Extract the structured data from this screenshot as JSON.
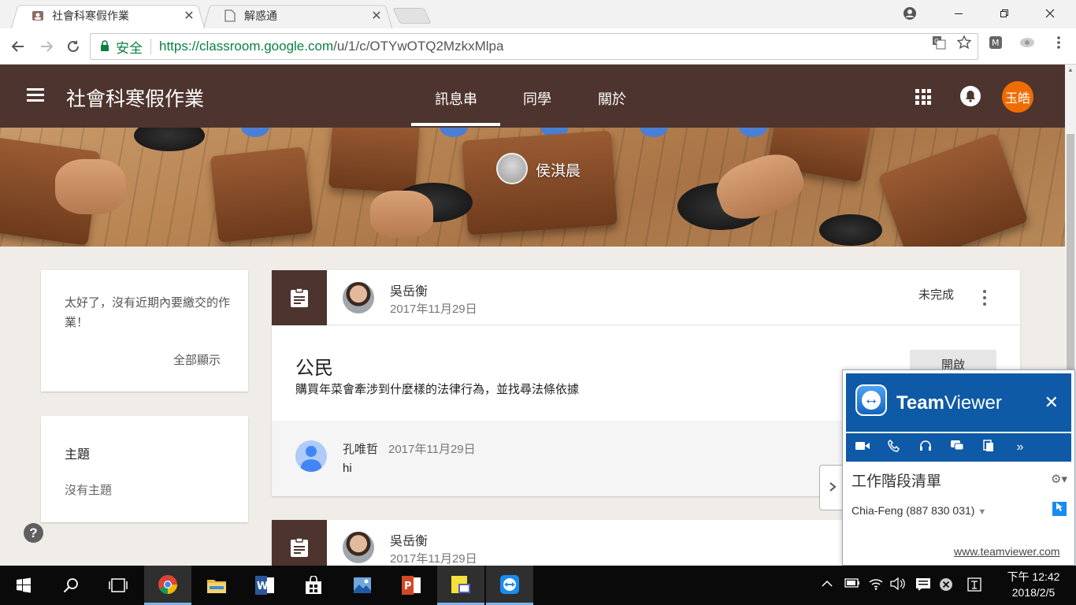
{
  "browser": {
    "tabs": [
      {
        "title": "社會科寒假作業",
        "active": true
      },
      {
        "title": "解惑通",
        "active": false
      }
    ],
    "security_label": "安全",
    "url_host": "https://classroom.google.com",
    "url_path": "/u/1/c/OTYwOTQ2MzkxMlpa"
  },
  "classroom": {
    "class_title": "社會科寒假作業",
    "nav": [
      "訊息串",
      "同學",
      "關於"
    ],
    "user_avatar": "玉皓",
    "banner_presenter": "侯淇晨"
  },
  "sidebar": {
    "upcoming_text": "太好了，沒有近期內要繳交的作業！",
    "view_all": "全部顯示",
    "topics_heading": "主題",
    "topics_empty": "沒有主題"
  },
  "posts": [
    {
      "author": "吳岳衡",
      "date": "2017年11月29日",
      "status": "未完成",
      "title": "公民",
      "description": "購買年菜會牽涉到什麼樣的法律行為，並找尋法條依據",
      "open_label": "開啟",
      "comment": {
        "author": "孔唯哲",
        "date": "2017年11月29日",
        "text": "hi"
      }
    },
    {
      "author": "吳岳衡",
      "date": "2017年11月29日"
    }
  ],
  "teamviewer": {
    "brand_bold": "Team",
    "brand_light": "Viewer",
    "section": "工作階段清單",
    "partner": "Chia-Feng (887 830 031)",
    "link": "www.teamviewer.com"
  },
  "taskbar": {
    "clock_time": "下午 12:42",
    "clock_date": "2018/2/5"
  },
  "colors": {
    "header": "#4e342e",
    "accent_orange": "#ef6c00",
    "secure_green": "#0b8043",
    "teamviewer_blue": "#0e5aa7"
  }
}
